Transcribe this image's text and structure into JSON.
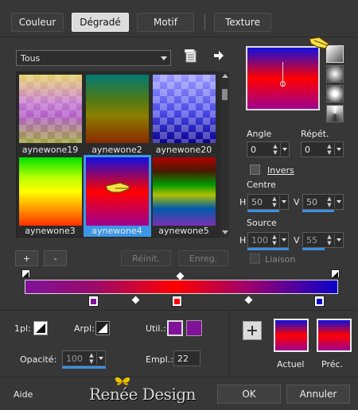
{
  "tabs": [
    {
      "label": "Couleur",
      "active": false
    },
    {
      "label": "Dégradé",
      "active": true
    },
    {
      "label": "Motif",
      "active": false
    },
    {
      "label": "Texture",
      "active": false
    }
  ],
  "category": {
    "selected": "Tous"
  },
  "gradients": [
    {
      "name": "aynewone19"
    },
    {
      "name": "aynewone2"
    },
    {
      "name": "aynewone20"
    },
    {
      "name": "aynewone3"
    },
    {
      "name": "aynewone4",
      "selected": true
    },
    {
      "name": "aynewone5"
    }
  ],
  "buttons": {
    "add": "+",
    "remove": "-",
    "reset": "Réinit.",
    "save": "Enreg.",
    "ok": "OK",
    "cancel": "Annuler",
    "help": "Aide"
  },
  "properties": {
    "angle_label": "Angle",
    "angle_value": "0",
    "repeat_label": "Répét.",
    "repeat_value": "0",
    "invert_label": "Invers",
    "invert_checked": false,
    "center_label": "Centre",
    "center_h_label": "H",
    "center_h": "50",
    "center_v_label": "V",
    "center_v": "50",
    "source_label": "Source",
    "source_h_label": "H",
    "source_h": "100",
    "source_v_label": "V",
    "source_v": "55",
    "link_label": "Liaison",
    "link_checked": false
  },
  "stop_controls": {
    "one_pl_label": "1pl:",
    "arpl_label": "Arpl:",
    "util_label": "Util.:",
    "opacity_label": "Opacité:",
    "opacity_value": "100",
    "location_label": "Empl.:",
    "location_value": "22"
  },
  "preview": {
    "current_label": "Actuel",
    "previous_label": "Préc."
  },
  "footer": {
    "brand": "Renée Design"
  },
  "colors": {
    "purple": "#80129a",
    "red": "#ff0000",
    "blue": "#0c00c8",
    "selection": "#3c98e6"
  }
}
